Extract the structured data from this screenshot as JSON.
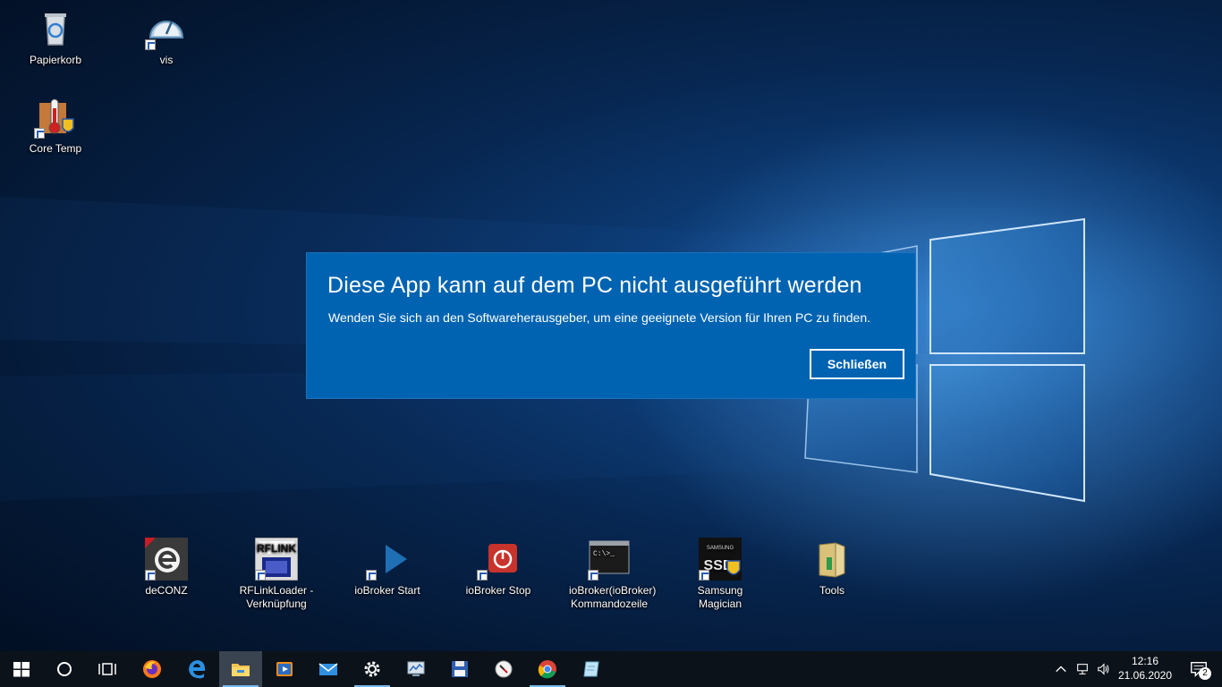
{
  "desktop": {
    "icons": [
      {
        "label": "Papierkorb",
        "icon": "recycle-bin-icon"
      },
      {
        "label": "vis",
        "icon": "gauge-icon"
      },
      {
        "label": "Core Temp",
        "icon": "thermometer-icon"
      },
      {
        "label": "deCONZ",
        "icon": "deconz-icon"
      },
      {
        "label": "RFLinkLoader - Verknüpfung",
        "icon": "rflink-icon"
      },
      {
        "label": "ioBroker Start",
        "icon": "play-icon"
      },
      {
        "label": "ioBroker Stop",
        "icon": "power-icon"
      },
      {
        "label": "ioBroker(ioBroker) Kommandozeile",
        "icon": "console-icon"
      },
      {
        "label": "Samsung Magician",
        "icon": "samsung-ssd-icon"
      },
      {
        "label": "Tools",
        "icon": "folder-icon"
      }
    ],
    "rflink_text": "RFLINK",
    "console_text": "C:\\>_",
    "samsung_text": "SAMSUNG",
    "ssd_text": "SSD"
  },
  "dialog": {
    "title": "Diese App kann auf dem PC nicht ausgeführt werden",
    "message": "Wenden Sie sich an den Softwareherausgeber, um eine geeignete Version für Ihren PC zu finden.",
    "close_label": "Schließen",
    "background_color": "#0063b1"
  },
  "taskbar": {
    "items": [
      {
        "name": "start",
        "icon": "windows-start-icon"
      },
      {
        "name": "cortana",
        "icon": "cortana-circle-icon"
      },
      {
        "name": "task-view",
        "icon": "task-view-icon"
      },
      {
        "name": "firefox",
        "icon": "firefox-icon"
      },
      {
        "name": "edge",
        "icon": "edge-icon"
      },
      {
        "name": "file-explorer",
        "icon": "file-explorer-icon"
      },
      {
        "name": "media-player",
        "icon": "media-player-icon"
      },
      {
        "name": "mail",
        "icon": "mail-icon"
      },
      {
        "name": "settings",
        "icon": "settings-gear-icon"
      },
      {
        "name": "performance-monitor",
        "icon": "monitor-chart-icon"
      },
      {
        "name": "save-app",
        "icon": "floppy-disk-icon"
      },
      {
        "name": "clock-app",
        "icon": "compass-icon"
      },
      {
        "name": "chrome",
        "icon": "chrome-icon"
      },
      {
        "name": "notepad-app",
        "icon": "pad-icon"
      }
    ],
    "clock": {
      "time": "12:16",
      "date": "21.06.2020"
    },
    "notification_count": "2"
  }
}
